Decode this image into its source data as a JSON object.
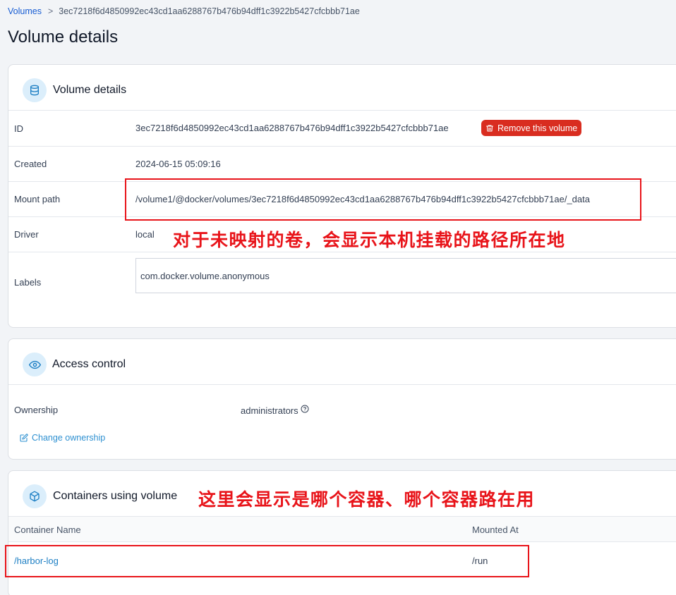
{
  "breadcrumb": {
    "parent": "Volumes",
    "separator": ">",
    "current": "3ec7218f6d4850992ec43cd1aa6288767b476b94dff1c3922b5427cfcbbb71ae"
  },
  "page_title": "Volume details",
  "details_card": {
    "title": "Volume details",
    "icon": "database-icon",
    "rows": {
      "id": {
        "label": "ID",
        "value": "3ec7218f6d4850992ec43cd1aa6288767b476b94dff1c3922b5427cfcbbb71ae"
      },
      "created": {
        "label": "Created",
        "value": "2024-06-15 05:09:16"
      },
      "mount_path": {
        "label": "Mount path",
        "value": "/volume1/@docker/volumes/3ec7218f6d4850992ec43cd1aa6288767b476b94dff1c3922b5427cfcbbb71ae/_data"
      },
      "driver": {
        "label": "Driver",
        "value": "local"
      },
      "labels": {
        "label": "Labels",
        "value": "com.docker.volume.anonymous"
      }
    },
    "remove_button": "Remove this volume"
  },
  "access_card": {
    "title": "Access control",
    "icon": "eye-icon",
    "ownership_label": "Ownership",
    "ownership_value": "administrators",
    "change_link": "Change ownership"
  },
  "containers_card": {
    "title": "Containers using volume",
    "icon": "cube-icon",
    "columns": [
      "Container Name",
      "Mounted At"
    ],
    "rows": [
      {
        "name": "/harbor-log",
        "mounted_at": "/run"
      }
    ]
  },
  "annotations": {
    "mount_note": "对于未映射的卷，会显示本机挂载的路径所在地",
    "containers_note": "这里会显示是哪个容器、哪个容器路在用"
  },
  "colors": {
    "accent": "#175cd3",
    "danger": "#d92d20",
    "annotation": "#e8141a",
    "icon_bg": "#dbeefb"
  }
}
